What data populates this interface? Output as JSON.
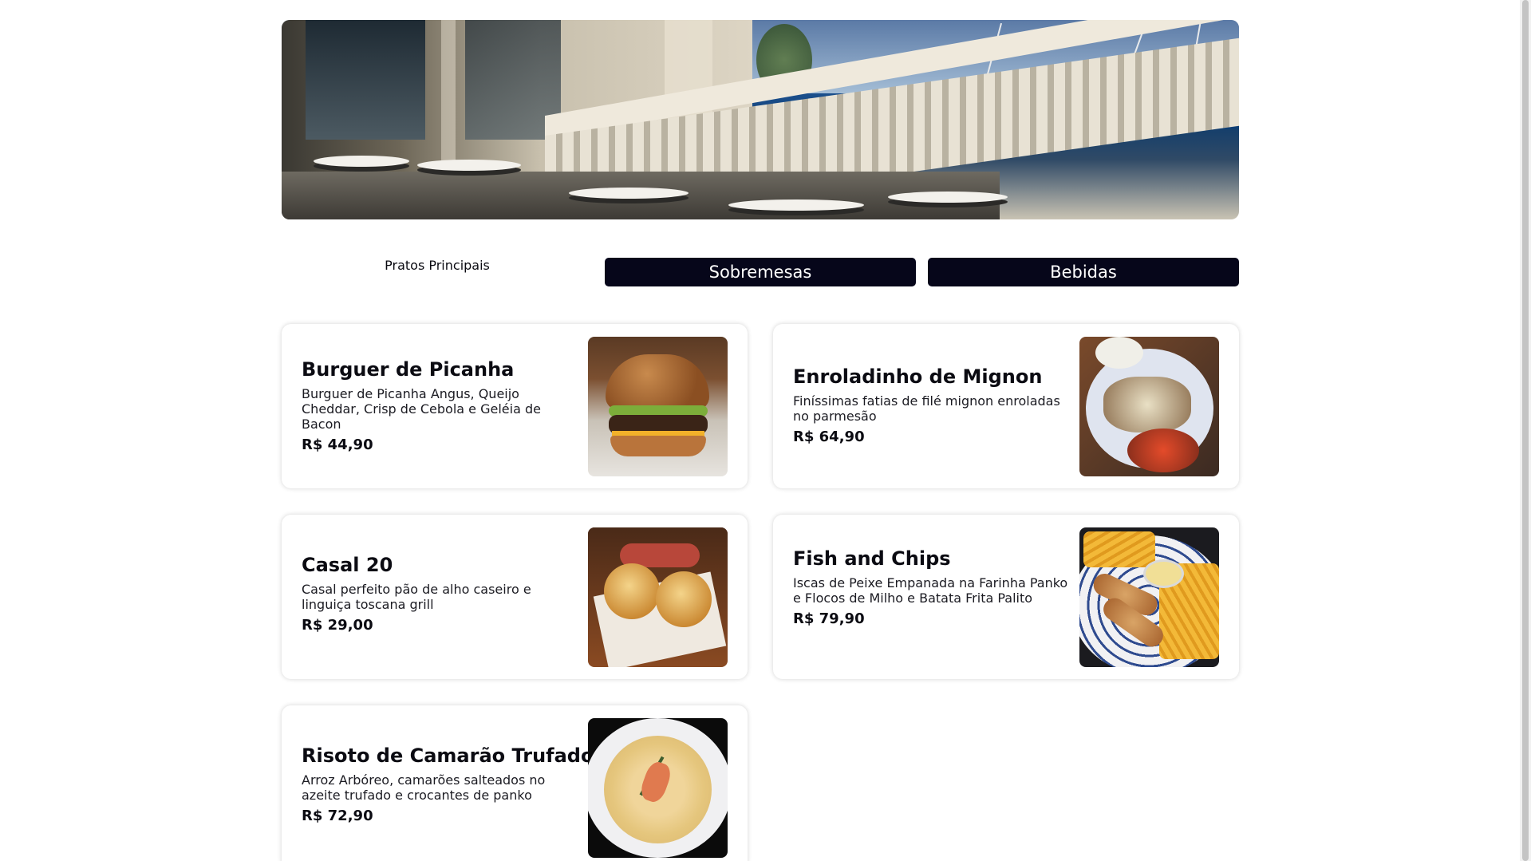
{
  "tabs": {
    "main": "Pratos Principais",
    "desserts": "Sobremesas",
    "drinks": "Bebidas"
  },
  "menu": {
    "items": [
      {
        "title": "Burguer de Picanha",
        "description": "Burguer de Picanha Angus, Queijo Cheddar, Crisp de Cebola e Geléia de Bacon",
        "price": "R$ 44,90"
      },
      {
        "title": "Enroladinho de Mignon",
        "description": "Finíssimas fatias de filé mignon enroladas no parmesão",
        "price": "R$ 64,90"
      },
      {
        "title": "Casal 20",
        "description": "Casal perfeito pão de alho caseiro e linguiça toscana grill",
        "price": "R$ 29,00"
      },
      {
        "title": "Fish and Chips",
        "description": "Iscas de Peixe Empanada na Farinha Panko e Flocos de Milho e Batata Frita Palito",
        "price": "R$ 79,90"
      },
      {
        "title": "Risoto de Camarão Trufado",
        "description": "Arroz Arbóreo, camarões salteados no azeite trufado e crocantes de panko",
        "price": "R$ 72,90"
      }
    ]
  },
  "colors": {
    "tab_active_bg": "#06061a",
    "text": "#0b0b12",
    "card_bg": "#ffffff"
  }
}
